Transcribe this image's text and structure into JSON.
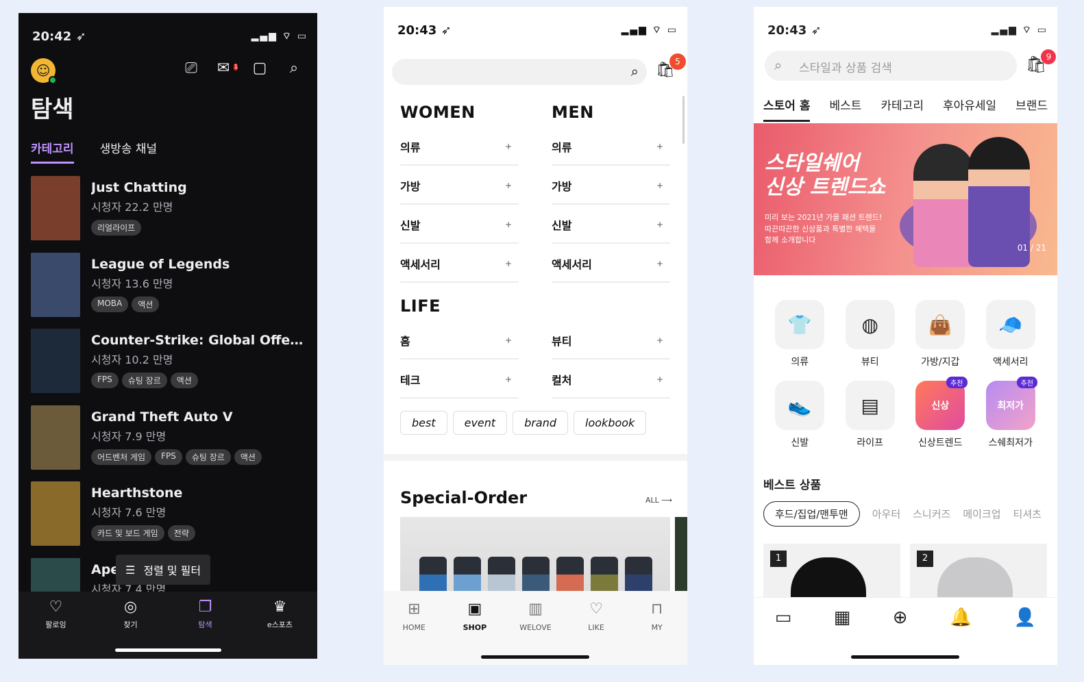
{
  "twitch": {
    "status": {
      "time": "20:42 ➶",
      "icons": "▂▄▆ ⌔ ▭"
    },
    "mail_badge": "1",
    "page_title": "탐색",
    "tabs": [
      "카테고리",
      "생방송 채널"
    ],
    "games": [
      {
        "name": "Just Chatting",
        "viewers": "시청자 22.2 만명",
        "tags": [
          "리얼라이프"
        ],
        "color": "#7a3f2c"
      },
      {
        "name": "League of Legends",
        "viewers": "시청자 13.6 만명",
        "tags": [
          "MOBA",
          "액션"
        ],
        "color": "#3a4a6b"
      },
      {
        "name": "Counter-Strike: Global Offens...",
        "viewers": "시청자 10.2 만명",
        "tags": [
          "FPS",
          "슈팅 장르",
          "액션"
        ],
        "color": "#1d2a3a"
      },
      {
        "name": "Grand Theft Auto V",
        "viewers": "시청자 7.9 만명",
        "tags": [
          "어드벤처 게임",
          "FPS",
          "슈팅 장르",
          "액션"
        ],
        "color": "#6b5b3a"
      },
      {
        "name": "Hearthstone",
        "viewers": "시청자 7.6 만명",
        "tags": [
          "카드 및 보드 게임",
          "전략"
        ],
        "color": "#8a6a2a"
      },
      {
        "name": "Ape",
        "viewers": "시청자 7.4 만명",
        "tags": [],
        "color": "#2b4b4b"
      }
    ],
    "sort_label": "정렬 및 필터",
    "nav": [
      {
        "label": "팔로잉",
        "icon": "♡"
      },
      {
        "label": "찾기",
        "icon": "◎"
      },
      {
        "label": "탐색",
        "icon": "❐"
      },
      {
        "label": "e스포츠",
        "icon": "♛"
      }
    ]
  },
  "shop": {
    "status": {
      "time": "20:43 ➶",
      "icons": "▂▄▆ ⌔ ▭"
    },
    "cart_badge": "5",
    "women": {
      "title": "WOMEN",
      "items": [
        "의류",
        "가방",
        "신발",
        "액세서리"
      ]
    },
    "men": {
      "title": "MEN",
      "items": [
        "의류",
        "가방",
        "신발",
        "액세서리"
      ]
    },
    "life": {
      "title": "LIFE",
      "left": [
        "홈",
        "테크"
      ],
      "right": [
        "뷰티",
        "컬처"
      ]
    },
    "plus": "+",
    "chips": [
      "best",
      "event",
      "brand",
      "lookbook"
    ],
    "special_title": "Special-Order",
    "special_all": "ALL ⟶",
    "nav": [
      {
        "label": "HOME",
        "icon": "⊞"
      },
      {
        "label": "SHOP",
        "icon": "▣"
      },
      {
        "label": "WELOVE",
        "icon": "▥"
      },
      {
        "label": "LIKE",
        "icon": "♡"
      },
      {
        "label": "MY",
        "icon": "⊓"
      }
    ]
  },
  "store": {
    "status": {
      "time": "20:43 ➶",
      "icons": "▂▄▆ ⌔ ▭"
    },
    "search_placeholder": "스타일과 상품 검색",
    "cart_badge": "9",
    "tabs": [
      "스토어 홈",
      "베스트",
      "카테고리",
      "후아유세일",
      "브랜드"
    ],
    "banner": {
      "headline_1": "스타일쉐어",
      "headline_2": "신상 트렌드쇼",
      "sub_1": "미리 보는 2021년 가을 패션 트렌드!",
      "sub_2": "따끈따끈한 신상품과 특별한 혜택을",
      "sub_3": "함께 소개합니다",
      "page": "01 / 21"
    },
    "categories": [
      {
        "label": "의류",
        "icon": "👕",
        "rec": ""
      },
      {
        "label": "뷰티",
        "icon": "◍",
        "rec": ""
      },
      {
        "label": "가방/지갑",
        "icon": "👜",
        "rec": ""
      },
      {
        "label": "액세서리",
        "icon": "🧢",
        "rec": ""
      },
      {
        "label": "신발",
        "icon": "👟",
        "rec": ""
      },
      {
        "label": "라이프",
        "icon": "▤",
        "rec": ""
      },
      {
        "label": "신상트렌드",
        "icon": "신상",
        "rec": "추천"
      },
      {
        "label": "스쉐최저가",
        "icon": "최저가",
        "rec": "추천"
      }
    ],
    "best_title": "베스트 상품",
    "filters": [
      "후드/집업/맨투맨",
      "아우터",
      "스니커즈",
      "메이크업",
      "티셔츠"
    ],
    "products": [
      {
        "rank": "1"
      },
      {
        "rank": "2"
      }
    ],
    "nav": [
      "▭",
      "▦",
      "⊕",
      "🔔",
      "👤"
    ]
  }
}
